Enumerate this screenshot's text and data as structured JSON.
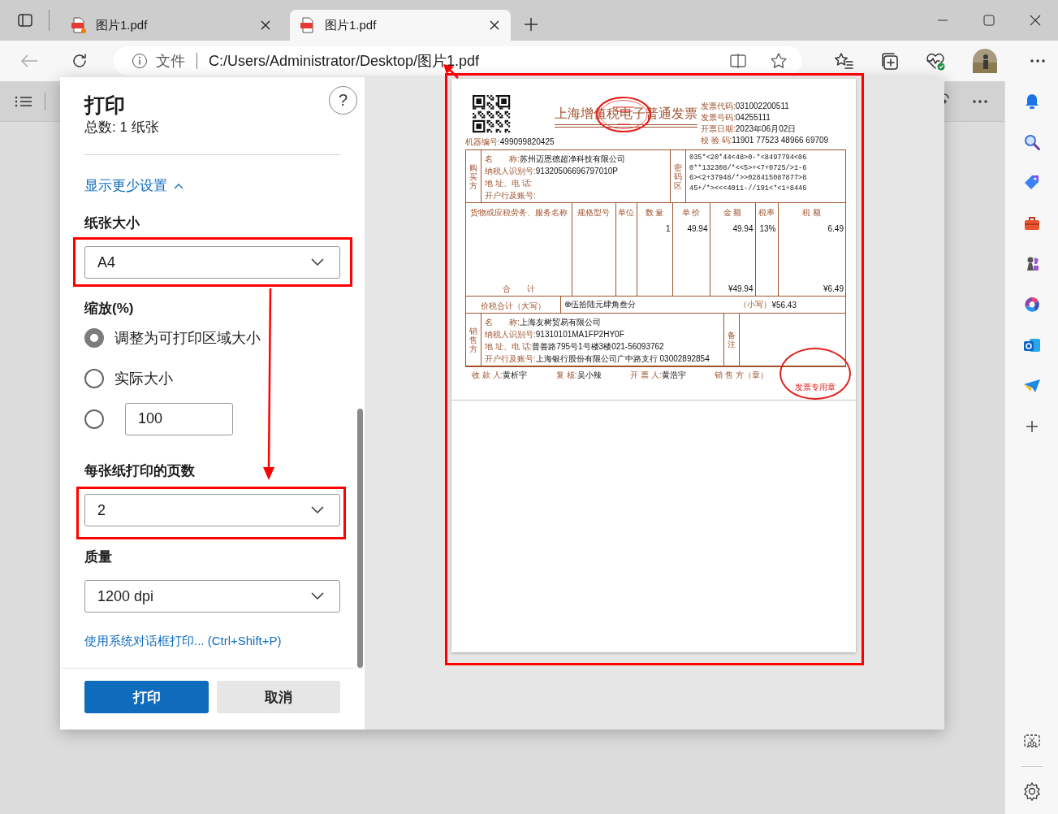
{
  "browser": {
    "tabs": [
      {
        "title": "图片1.pdf",
        "selected": false,
        "unread": true
      },
      {
        "title": "图片1.pdf",
        "selected": true,
        "unread": false
      }
    ],
    "address": {
      "scheme": "文件",
      "url": "C:/Users/Administrator/Desktop/图片1.pdf"
    }
  },
  "print_dialog": {
    "title": "打印",
    "help_button": "?",
    "summary": "总数: 1 纸张",
    "settings_link": "显示更少设置",
    "paper_size": {
      "label": "纸张大小",
      "value": "A4"
    },
    "scale": {
      "label": "缩放(%)",
      "options": [
        {
          "label": "调整为可打印区域大小",
          "selected": true
        },
        {
          "label": "实际大小",
          "selected": false
        },
        {
          "value": "100",
          "selected": false
        }
      ]
    },
    "pages_per_sheet": {
      "label": "每张纸打印的页数",
      "value": "2"
    },
    "quality": {
      "label": "质量",
      "value": "1200 dpi"
    },
    "system_dialog_link": "使用系统对话框打印... (Ctrl+Shift+P)",
    "buttons": [
      {
        "label": "打印",
        "kind": "primary"
      },
      {
        "label": "取消",
        "kind": "secondary"
      }
    ]
  },
  "invoice": {
    "title": "上海增值税电子普通发票",
    "machine_no": {
      "label": "机器编号:",
      "value": "499099820425"
    },
    "meta": [
      {
        "label": "发票代码:",
        "value": "031002200511"
      },
      {
        "label": "发票号码:",
        "value": "04255111"
      },
      {
        "label": "开票日期:",
        "value": "2023年06月02日"
      },
      {
        "label": "校 验 码:",
        "value": "11901 77523 48966 69709"
      }
    ],
    "buyer": {
      "side_label": "购买方",
      "fields": [
        {
          "label": "名　　称:",
          "value": "苏州迈恩德超净科技有限公司"
        },
        {
          "label": "纳税人识别号:",
          "value": "91320506696797010P"
        },
        {
          "label": "地 址、电 话:"
        },
        {
          "label": "开户行及账号:"
        }
      ],
      "cipher_label": "密码区",
      "cipher": [
        "035*<20*44<48>0-*<8497794<06",
        "0**132308/*<<5>+<7+0725/>1-6",
        "6><2+37948/*>>028415087877>8",
        "45+/*><<<4011-//191<*<1+8446"
      ]
    },
    "goods": {
      "columns": [
        "货物或应税劳务、服务名称",
        "规格型号",
        "单位",
        "数 量",
        "单 价",
        "金 额",
        "税率",
        "税 额"
      ],
      "rows": [
        {
          "quantity": "1",
          "unit_price": "49.94",
          "amount": "49.94",
          "tax_rate": "13%",
          "tax": "6.49"
        }
      ],
      "total": {
        "label": "合　　计",
        "amount": "¥49.94",
        "tax": "¥6.49"
      }
    },
    "grand_total": {
      "label": "价税合计（大写）",
      "words": "⊗伍拾陆元肆角叁分",
      "figure_label": "（小写）",
      "figure": "¥56.43"
    },
    "seller": {
      "side_label": "销售方",
      "fields": [
        {
          "label": "名　　称:",
          "value": "上海友树贸易有限公司"
        },
        {
          "label": "纳税人识别号:",
          "value": "91310101MA1FP2HY0F"
        },
        {
          "label": "地 址、电 话:",
          "value": "普善路795号1号楼3楼021-56093762"
        },
        {
          "label": "开户行及账号:",
          "value": "上海银行股份有限公司广中路支行 03002892854"
        }
      ],
      "remark_label": "备注"
    },
    "signatures": [
      {
        "label": "收 款 人:",
        "value": "黄析宇"
      },
      {
        "label": "复 核:",
        "value": "吴小辣"
      },
      {
        "label": "开 票 人:",
        "value": "黄浩宇"
      },
      {
        "label": "销 售 方（章）"
      }
    ],
    "seal_text": "发票专用章"
  }
}
